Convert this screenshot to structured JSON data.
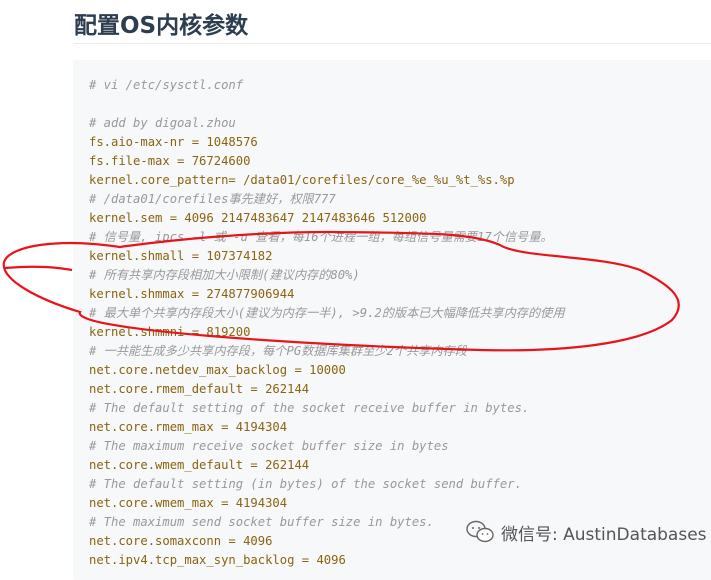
{
  "heading": "配置OS内核参数",
  "code_lines": [
    {
      "type": "comment",
      "text": "# vi /etc/sysctl.conf"
    },
    {
      "type": "blank",
      "text": ""
    },
    {
      "type": "comment",
      "text": "# add by digoal.zhou"
    },
    {
      "type": "setting",
      "text": "fs.aio-max-nr = 1048576"
    },
    {
      "type": "setting",
      "text": "fs.file-max = 76724600"
    },
    {
      "type": "setting",
      "text": "kernel.core_pattern= /data01/corefiles/core_%e_%u_%t_%s.%p"
    },
    {
      "type": "comment",
      "text": "# /data01/corefiles事先建好，权限777"
    },
    {
      "type": "setting",
      "text": "kernel.sem = 4096 2147483647 2147483646 512000"
    },
    {
      "type": "comment",
      "text": "# 信号量, ipcs -l 或 -u 查看，每16个进程一组，每组信号量需要17个信号量。"
    },
    {
      "type": "setting",
      "text": "kernel.shmall = 107374182"
    },
    {
      "type": "comment",
      "text": "# 所有共享内存段相加大小限制(建议内存的80%)"
    },
    {
      "type": "setting",
      "text": "kernel.shmmax = 274877906944"
    },
    {
      "type": "comment",
      "text": "# 最大单个共享内存段大小(建议为内存一半), >9.2的版本已大幅降低共享内存的使用"
    },
    {
      "type": "setting",
      "text": "kernel.shmmni = 819200"
    },
    {
      "type": "comment",
      "text": "# 一共能生成多少共享内存段，每个PG数据库集群至少2个共享内存段"
    },
    {
      "type": "setting",
      "text": "net.core.netdev_max_backlog = 10000"
    },
    {
      "type": "setting",
      "text": "net.core.rmem_default = 262144"
    },
    {
      "type": "comment",
      "text": "# The default setting of the socket receive buffer in bytes."
    },
    {
      "type": "setting",
      "text": "net.core.rmem_max = 4194304"
    },
    {
      "type": "comment",
      "text": "# The maximum receive socket buffer size in bytes"
    },
    {
      "type": "setting",
      "text": "net.core.wmem_default = 262144"
    },
    {
      "type": "comment",
      "text": "# The default setting (in bytes) of the socket send buffer."
    },
    {
      "type": "setting",
      "text": "net.core.wmem_max = 4194304"
    },
    {
      "type": "comment",
      "text": "# The maximum send socket buffer size in bytes."
    },
    {
      "type": "setting",
      "text": "net.core.somaxconn = 4096"
    },
    {
      "type": "setting",
      "text": "net.ipv4.tcp_max_syn_backlog = 4096"
    }
  ],
  "watermark": {
    "icon": "wechat-icon",
    "text": "微信号: AustinDatabases"
  },
  "colors": {
    "annotation": "#e8141c",
    "comment": "#999999",
    "setting": "#8a6410"
  }
}
